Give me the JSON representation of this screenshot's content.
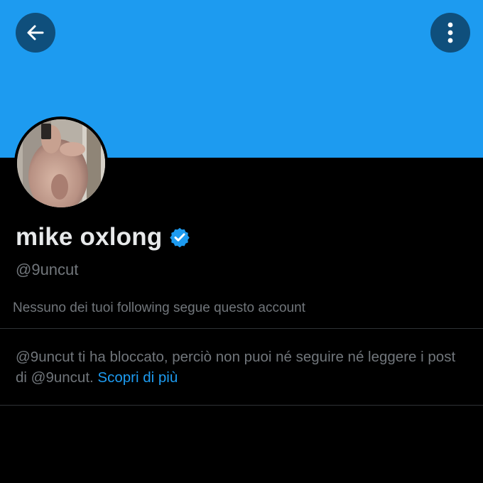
{
  "profile": {
    "display_name": "mike oxlong",
    "handle": "@9uncut",
    "verified": true,
    "followers_you_know": "Nessuno dei tuoi following segue questo account"
  },
  "blocked_notice": {
    "text": "@9uncut ti ha bloccato, perciò non puoi né seguire né leggere i post di @9uncut.",
    "link_label": "Scopri di più"
  },
  "header": {
    "back_icon": "arrow-left-icon",
    "more_icon": "more-vertical-icon"
  },
  "colors": {
    "banner": "#1d9bf0",
    "background": "#000000",
    "primary_text": "#e7e9ea",
    "secondary_text": "#71767b",
    "accent": "#1d9bf0",
    "header_button": "#0f4f7c"
  }
}
